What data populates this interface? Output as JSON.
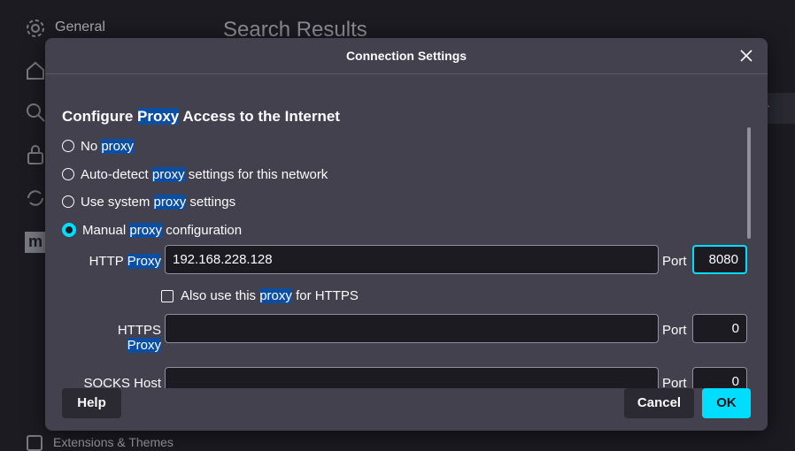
{
  "background": {
    "sidebar_general_label": "General",
    "page_title": "Search Results",
    "extensions_label": "Extensions & Themes",
    "icons": [
      "gear-icon",
      "home-icon",
      "search-icon",
      "lock-icon",
      "sync-icon",
      "mozilla-icon"
    ]
  },
  "dialog": {
    "title": "Connection Settings",
    "heading_pre": "Configure ",
    "heading_hl": "Proxy",
    "heading_post": " Access to the Internet",
    "options": [
      {
        "pre": "No ",
        "hl": "proxy",
        "post": "",
        "checked": false
      },
      {
        "pre": "Auto-detect ",
        "hl": "proxy",
        "post": " settings for this network",
        "checked": false
      },
      {
        "pre": "Use system ",
        "hl": "proxy",
        "post": " settings",
        "checked": false
      },
      {
        "pre": "Manual ",
        "hl": "proxy",
        "post": " configuration",
        "checked": true
      }
    ],
    "http_label_pre": "HTTP ",
    "http_label_hl": "Proxy",
    "http_value": "192.168.228.128",
    "port_label": "Port",
    "http_port": "8080",
    "also_use_pre": "Also use this ",
    "also_use_hl": "proxy",
    "also_use_post": " for HTTPS",
    "also_use_checked": false,
    "https_label_pre": "HTTPS ",
    "https_label_hl": "Proxy",
    "https_value": "",
    "https_port": "0",
    "socks_label": "SOCKS Host",
    "socks_value": "",
    "socks_port": "0",
    "help_label": "Help",
    "cancel_label": "Cancel",
    "ok_label": "OK"
  },
  "colors": {
    "accent": "#00ddff",
    "highlight": "#0b4ea2",
    "dialog_bg": "#42414d",
    "input_bg": "#1c1b22"
  }
}
